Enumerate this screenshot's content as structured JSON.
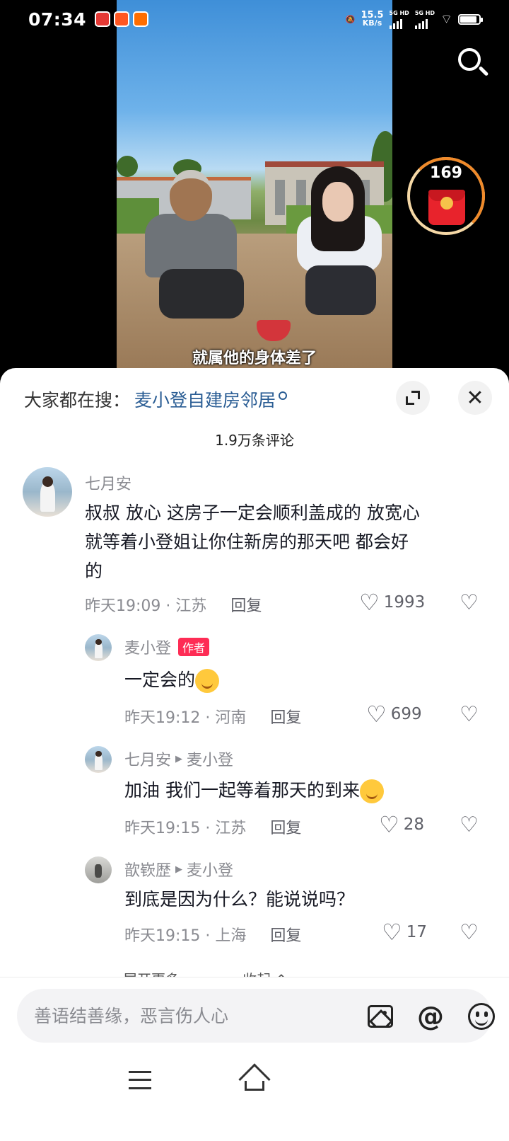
{
  "status_bar": {
    "time": "07:34",
    "net_speed_value": "15.5",
    "net_speed_unit": "KB/s",
    "sig1_label": "5G HD",
    "sig2_label": "5G HD"
  },
  "video": {
    "subtitle": "就属他的身体差了"
  },
  "reward": {
    "count": "169"
  },
  "sheet": {
    "hot_search_label": "大家都在搜：",
    "hot_search_keyword": "麦小登自建房邻居",
    "comment_count": "1.9万条评论"
  },
  "comments": [
    {
      "name": "七月安",
      "text_line1": "叔叔 放心 这房子一定会顺利盖成的 放宽心",
      "text_line2": "就等着小登姐让你住新房的那天吧 都会好",
      "text_line3": "的",
      "meta": "昨天19:09 · 江苏",
      "reply_label": "回复",
      "likes": "1993"
    },
    {
      "name": "麦小登",
      "author_tag": "作者",
      "text": "一定会的",
      "meta": "昨天19:12 · 河南",
      "reply_label": "回复",
      "likes": "699"
    },
    {
      "name": "七月安",
      "reply_to": "麦小登",
      "text": "加油 我们一起等着那天的到来",
      "meta": "昨天19:15 · 江苏",
      "reply_label": "回复",
      "likes": "28"
    },
    {
      "name": "歆嵚歴",
      "reply_to": "麦小登",
      "text": "到底是因为什么？能说说吗？",
      "meta": "昨天19:15 · 上海",
      "reply_label": "回复",
      "likes": "17"
    }
  ],
  "more_row": {
    "expand_label": "展开更多 ⌄",
    "collapse_label": "收起 ⌃"
  },
  "input": {
    "placeholder": "善语结善缘，恶言伤人心"
  }
}
